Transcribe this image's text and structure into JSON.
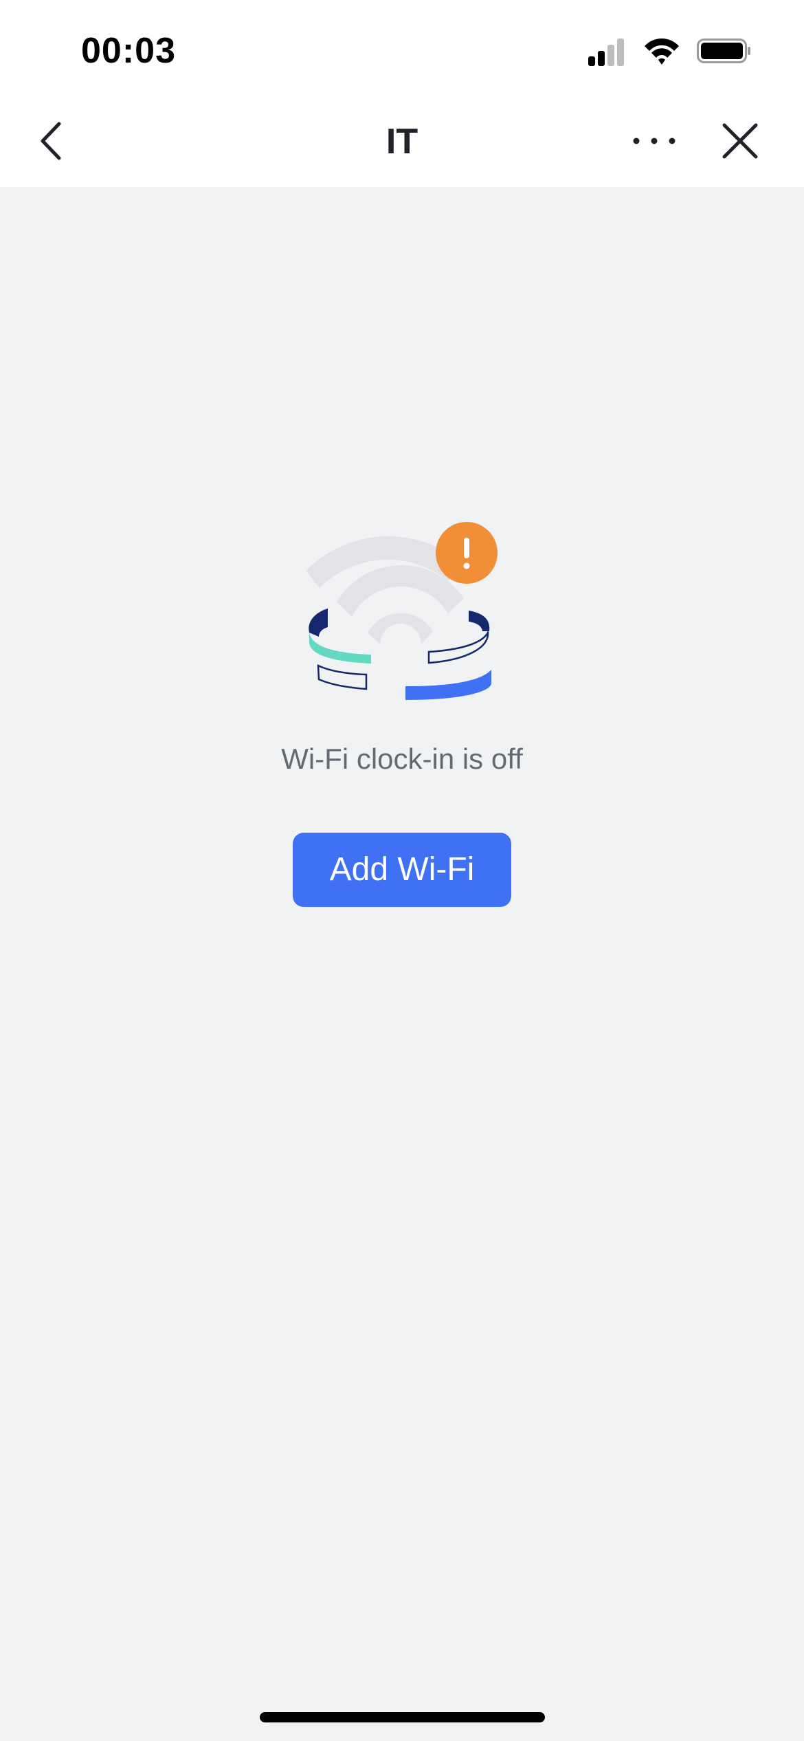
{
  "status_bar": {
    "time": "00:03",
    "icons": [
      "cellular-signal-icon",
      "wifi-icon",
      "battery-icon"
    ]
  },
  "nav": {
    "title": "IT",
    "icons": [
      "back-chevron-icon",
      "more-dots-icon",
      "close-icon"
    ]
  },
  "empty_state": {
    "illustration": "wifi-warning-illustration",
    "message": "Wi-Fi clock-in is off",
    "button_label": "Add Wi-Fi"
  },
  "colors": {
    "background": "#f1f2f4",
    "primary": "#4070f4",
    "warning": "#f18f38",
    "teal": "#64d8c0",
    "navy": "#14286e",
    "text_secondary": "#646a73"
  }
}
